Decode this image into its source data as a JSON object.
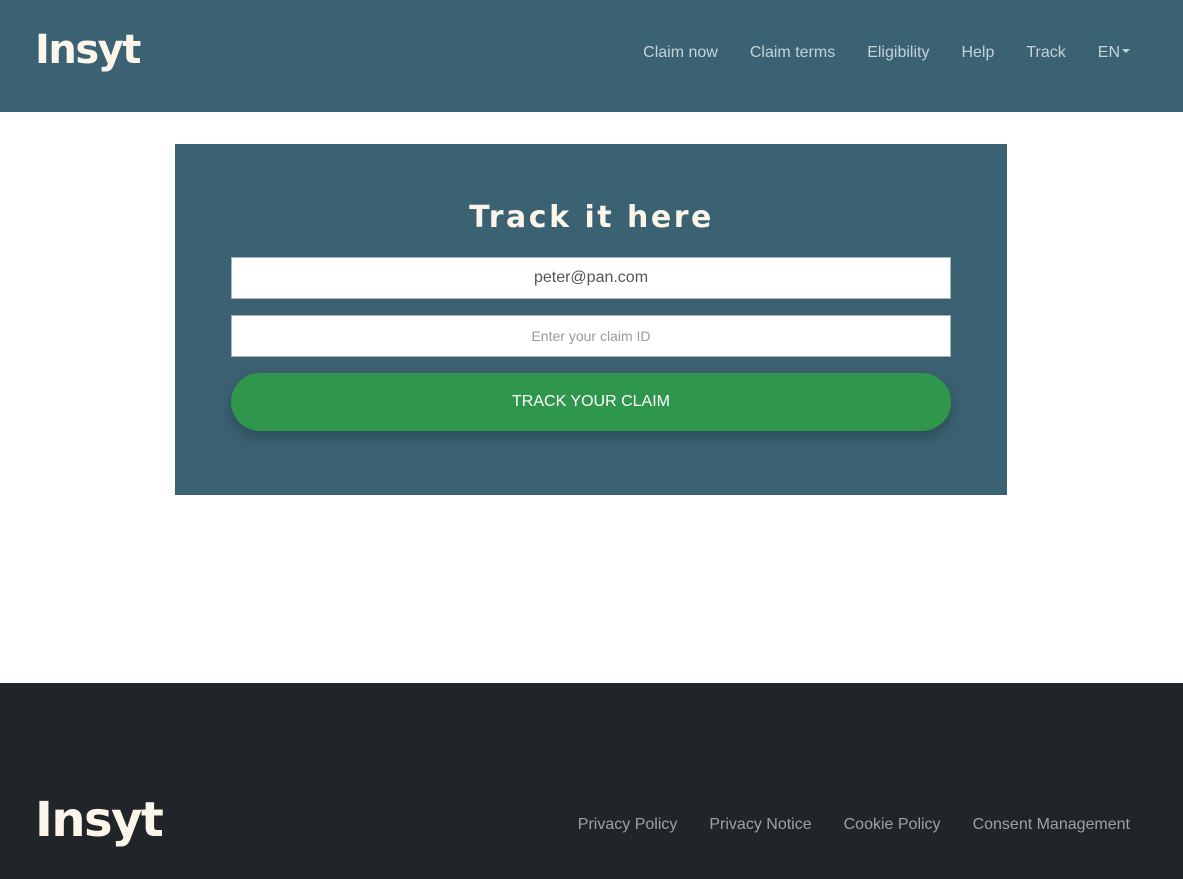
{
  "header": {
    "logo": "Insyt",
    "nav": {
      "claim_now": "Claim now",
      "claim_terms": "Claim terms",
      "eligibility": "Eligibility",
      "help": "Help",
      "track": "Track",
      "language": "EN"
    }
  },
  "main": {
    "title": "Track it here",
    "email_value": "peter@pan.com",
    "claim_id_placeholder": "Enter your claim ID",
    "claim_id_value": "",
    "track_button": "TRACK YOUR CLAIM"
  },
  "footer": {
    "logo": "Insyt",
    "links": {
      "privacy_policy": "Privacy Policy",
      "privacy_notice": "Privacy Notice",
      "cookie_policy": "Cookie Policy",
      "consent_management": "Consent Management"
    }
  },
  "colors": {
    "header_bg": "#3b6272",
    "card_bg": "#3b6272",
    "button_green": "#2f974c",
    "footer_bg": "#212428",
    "logo_cream": "#fbf5ea"
  },
  "icons": {
    "language_caret": "caret-down-icon"
  }
}
